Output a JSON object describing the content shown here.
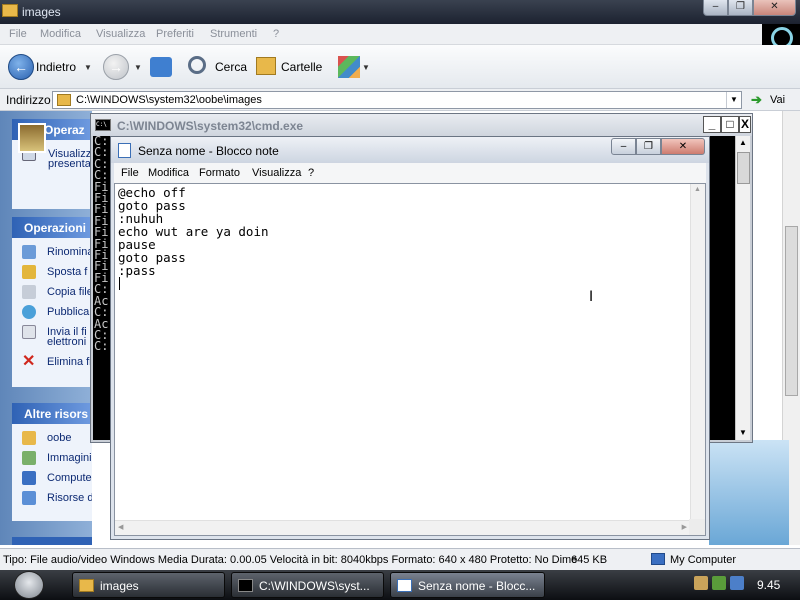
{
  "explorer": {
    "title": "images",
    "menu": [
      "File",
      "Modifica",
      "Visualizza",
      "Preferiti",
      "Strumenti",
      "?"
    ],
    "toolbar": {
      "back": "Indietro",
      "search": "Cerca",
      "folders": "Cartelle"
    },
    "address": {
      "label": "Indirizzo",
      "value": "C:\\WINDOWS\\system32\\oobe\\images",
      "go": "Vai"
    },
    "taskpane": {
      "picture_tasks_header": "Operaz",
      "picture_tasks": [
        "Visualizz",
        "presenta"
      ],
      "file_tasks_header": "Operazioni",
      "file_tasks": [
        "Rinomina",
        "Sposta f",
        "Copia file",
        "Pubblica",
        "Invia il fi",
        "elettroni",
        "Elimina fi"
      ],
      "other_header": "Altre risors",
      "other": [
        "oobe",
        "Immagini",
        "Computer",
        "Risorse di ret"
      ]
    },
    "status": {
      "info": "Tipo: File audio/video Windows Media Durata: 0.00.05 Velocità in bit: 8040kbps Formato: 640 x 480 Protetto: No Dime",
      "size": "645 KB",
      "location": "My Computer"
    }
  },
  "cmd": {
    "title": "C:\\WINDOWS\\system32\\cmd.exe",
    "lines": [
      "",
      "C:",
      "",
      "C:",
      "",
      "C:",
      "",
      "C:",
      "Fi",
      "Fi",
      "Fi",
      "Fi",
      "Fi",
      "Fi",
      "Fi",
      "Fi",
      "Fi",
      "C:",
      "Ac",
      "C:",
      "Ac",
      "",
      "C:",
      "",
      "C:"
    ]
  },
  "notepad": {
    "title": "Senza nome - Blocco note",
    "menu": [
      "File",
      "Modifica",
      "Formato",
      "Visualizza",
      "?"
    ],
    "lines": [
      "@echo off",
      "goto pass",
      ":nuhuh",
      "echo wut are ya doin",
      "pause",
      "goto pass",
      ":pass"
    ]
  },
  "taskbar": {
    "buttons": [
      "images",
      "C:\\WINDOWS\\syst...",
      "Senza nome - Blocc..."
    ],
    "clock": "9.45"
  },
  "colors": {
    "title_dark": "#1c2230",
    "task_pane_header": "#2f62b5",
    "cmd_background": "#000000",
    "taskbar": "#0c0e12"
  }
}
